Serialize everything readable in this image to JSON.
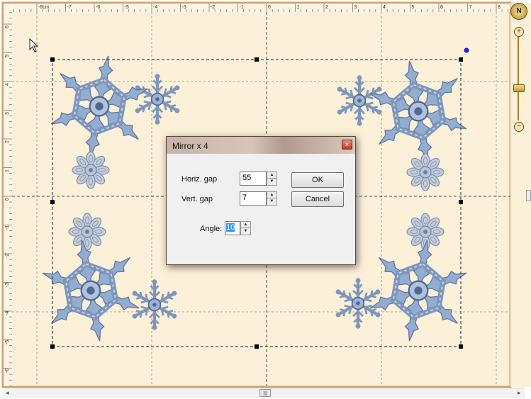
{
  "rulers": {
    "unit": "cm",
    "top_labels": [
      "-8cm",
      "-7",
      "-6",
      "-5",
      "-4",
      "-3",
      "-2",
      "-1",
      "0",
      "1",
      "2",
      "3",
      "4",
      "5",
      "6",
      "7",
      "8"
    ],
    "left_labels": [
      "6",
      "5",
      "4",
      "3",
      "2",
      "1",
      "0",
      "-1",
      "-2",
      "-3",
      "-4",
      "-5",
      "-6"
    ]
  },
  "dialog": {
    "title": "Mirror x 4",
    "close_glyph": "×",
    "horiz_gap_label": "Horiz. gap",
    "horiz_gap_value": "55",
    "vert_gap_label": "Vert. gap",
    "vert_gap_value": "7",
    "angle_label": "Angle:",
    "angle_value": "10",
    "ok_label": "OK",
    "cancel_label": "Cancel"
  },
  "navigator": {
    "compass_label": "N",
    "zoom_in": "+",
    "zoom_out": "−",
    "zoom_level": 0.6
  },
  "scrollbar": {
    "left_arrow": "◂",
    "right_arrow": "▸",
    "thumb_grip": "|||"
  },
  "colors": {
    "canvas_bg": "#fdf0d9",
    "border_accent": "#c9a36b",
    "snowflake_light": "#93add0",
    "snowflake_mid": "#7d97bc",
    "snowflake_dark": "#50698e",
    "selection_handle": "#000000",
    "rotate_handle": "#1a1aff",
    "close_button": "#c0392b"
  }
}
